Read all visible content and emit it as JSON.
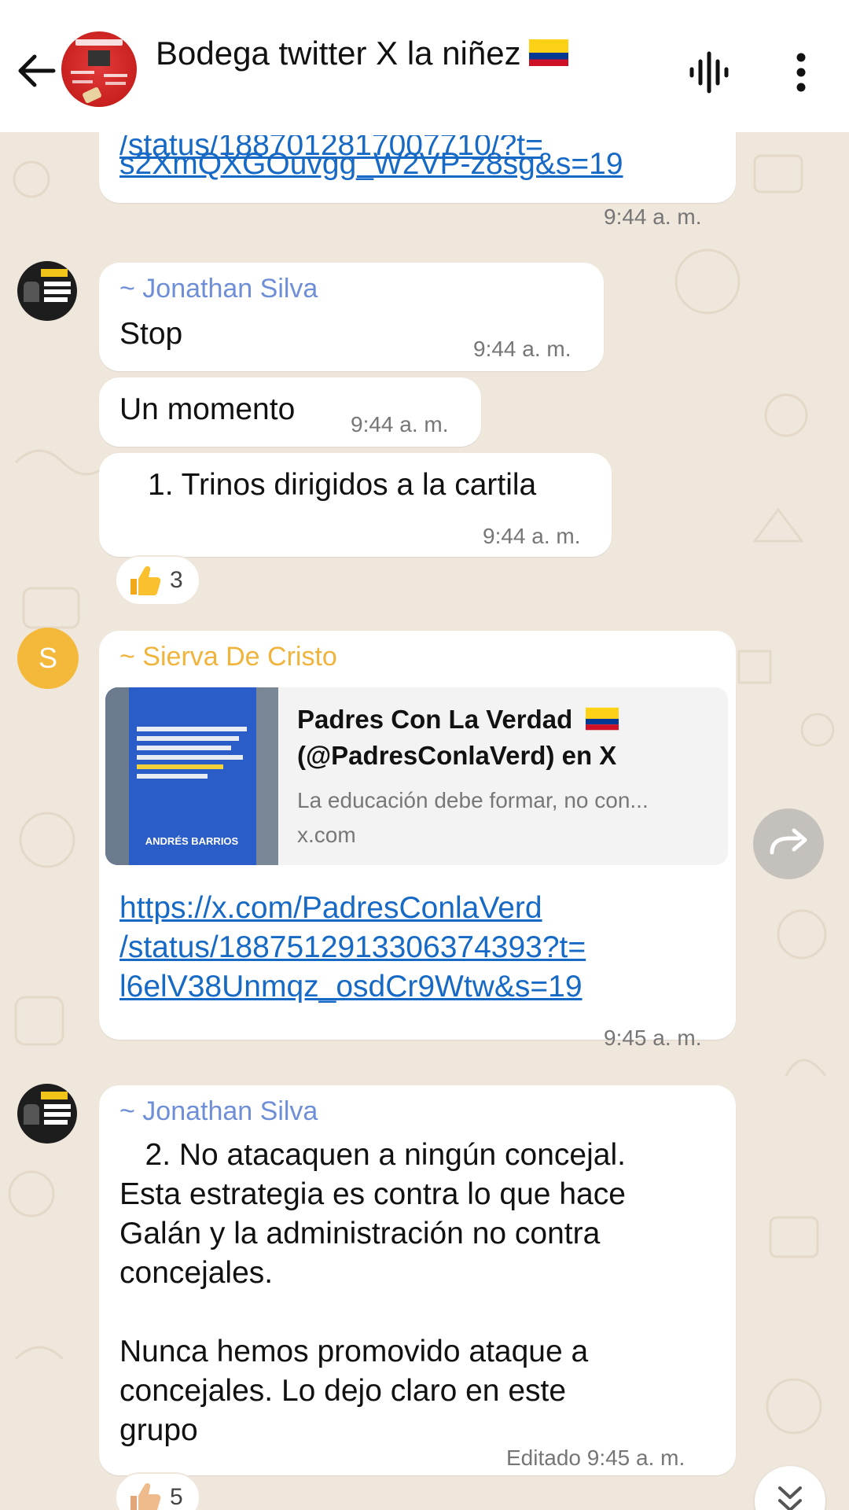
{
  "header": {
    "title": "Bodega twitter X la niñez",
    "flag": "colombia-flag"
  },
  "colors": {
    "chat_background": "#efe7dc",
    "link": "#1769c6",
    "sender_jonathan": "#6f8ed8",
    "sender_sierva": "#f0b43c"
  },
  "messages": {
    "m1": {
      "link_partial": "/status/1887012817007710/?t=",
      "link_line": "s2XmQXGOuvgg_W2VP-z8sg&s=19",
      "time": "9:44 a. m."
    },
    "m2": {
      "sender": "~ Jonathan Silva",
      "text": "Stop",
      "time": "9:44 a. m."
    },
    "m3": {
      "text": "Un momento",
      "time": "9:44 a. m."
    },
    "m4": {
      "text": "1. Trinos dirigidos a la cartila",
      "time": "9:44 a. m.",
      "reaction": {
        "emoji": "thumbs-up",
        "count": "3"
      }
    },
    "m5": {
      "avatar_letter": "S",
      "sender": "~ Sierva De Cristo",
      "preview": {
        "title_line1": "Padres Con La Verdad",
        "title_line2": "(@PadresConlaVerd) en X",
        "description": "La educación debe formar, no con...",
        "domain": "x.com",
        "thumb_name": "ANDRÉS BARRIOS"
      },
      "link_lines": [
        "https://x.com/PadresConlaVerd",
        "/status/1887512913306374393?t=",
        "l6elV38Unmqz_osdCr9Wtw&s=19"
      ],
      "time": "9:45 a. m."
    },
    "m6": {
      "sender": "~ Jonathan Silva",
      "lines": [
        "   2. No atacaquen a ningún concejal.",
        "Esta estrategia es contra lo que hace",
        "Galán y la administración no contra",
        "concejales.",
        "",
        "Nunca hemos promovido ataque a",
        "concejales. Lo dejo claro en este",
        "grupo"
      ],
      "time": "Editado 9:45 a. m.",
      "reaction": {
        "emoji": "thumbs-up",
        "count": "5"
      }
    }
  }
}
